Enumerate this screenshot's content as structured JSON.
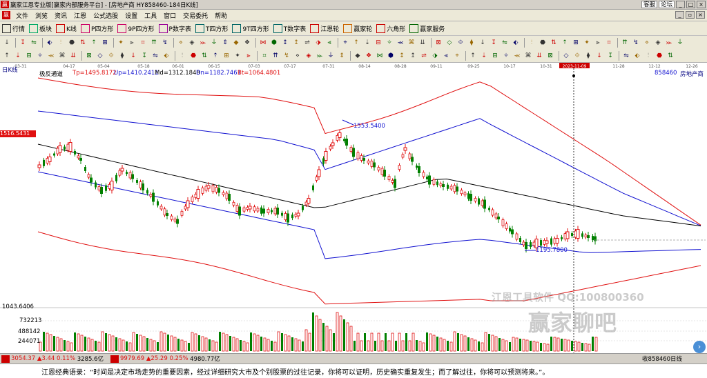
{
  "titlebar": {
    "logo": "赢",
    "title": "赢家江恩专业版[赢家内部服务平台] - [房地产商  HY858460-184日K线]",
    "links": [
      "客服",
      "论坛"
    ]
  },
  "menu": [
    "文件",
    "浏览",
    "资讯",
    "江恩",
    "公式选股",
    "设置",
    "工具",
    "窗口",
    "交易委托",
    "帮助"
  ],
  "toolbar1": [
    {
      "icon": "grid",
      "label": "行情"
    },
    {
      "icon": "block",
      "label": "板块"
    },
    {
      "icon": "kline",
      "label": "K线"
    },
    {
      "icon": "P",
      "label": "P四方形"
    },
    {
      "icon": "9P",
      "label": "9P四方形"
    },
    {
      "icon": "P",
      "label": "P数字表"
    },
    {
      "icon": "T",
      "label": "T四方形"
    },
    {
      "icon": "9T",
      "label": "9T四方形"
    },
    {
      "icon": "TN",
      "label": "T数字表"
    },
    {
      "icon": "wheel",
      "label": "江恩轮"
    },
    {
      "icon": "wheel2",
      "label": "赢家轮"
    },
    {
      "icon": "hex",
      "label": "六角形"
    },
    {
      "icon": "service",
      "label": "赢家服务"
    }
  ],
  "chart": {
    "period_label": "日K线",
    "indicator_name": "极反通道",
    "indicators": [
      {
        "name": "Tp",
        "value": "1495.8172",
        "color": "#e01010"
      },
      {
        "name": "Up",
        "value": "1410.2411",
        "color": "#1010d0"
      },
      {
        "name": "Md",
        "value": "1312.1848",
        "color": "#000000"
      },
      {
        "name": "Dn",
        "value": "1182.7461",
        "color": "#1010d0"
      },
      {
        "name": "Bt",
        "value": "1064.4801",
        "color": "#e01010"
      }
    ],
    "code": "858460",
    "name": "房地产商",
    "date_ticks": [
      "03-31",
      "04-17",
      "05-04",
      "05-18",
      "06-01",
      "06-15",
      "07-03",
      "07-17",
      "07-31",
      "08-14",
      "08-28",
      "09-11",
      "09-25",
      "10-17",
      "10-31",
      "2023-11-09",
      "11-28",
      "12-12",
      "12-26"
    ],
    "price_axis_marker": "1516.5431",
    "high_annotation": "1553.5400",
    "low_annotation": "1195.7800",
    "volume_labels": [
      "1043.6406",
      "732213",
      "488142",
      "244071"
    ]
  },
  "status": {
    "index1": {
      "value": "3054.37",
      "change": "▲3.44",
      "pct": "0.11%",
      "amount": "3285.6亿"
    },
    "index2": {
      "value": "9979.69",
      "change": "▲25.29",
      "pct": "0.25%",
      "amount": "4980.77亿"
    },
    "right_text": "收858460日线"
  },
  "bottom_text": "江恩经典语录：“时间是决定市场走势的重要因素，经过详细研究大市及个别股票的过往记录，你将可以证明，历史确实重复发生；而了解过往，你将可以预测将来。”。",
  "watermarks": {
    "software": "江恩工具软件  QQ:100800360",
    "forum": "赢家聊吧"
  },
  "colors": {
    "up": "#e01010",
    "down": "#008000",
    "tp": "#e01010",
    "up_line": "#1010d0",
    "md": "#000000"
  }
}
